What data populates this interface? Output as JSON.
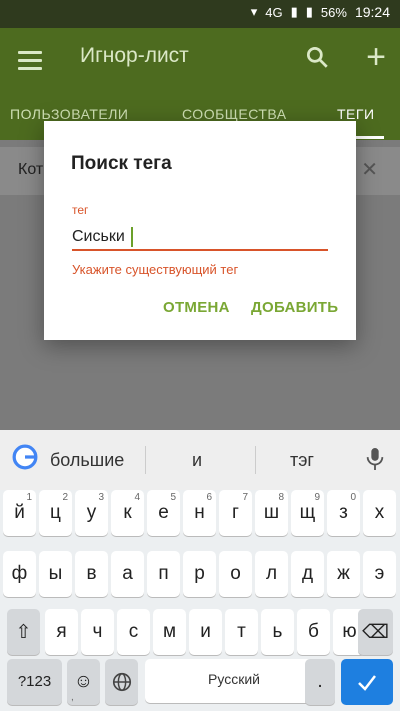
{
  "status": {
    "network": "4G",
    "battery": "56%",
    "time": "19:24"
  },
  "appbar": {
    "title": "Игнор-лист"
  },
  "tabs": [
    {
      "label": "ПОЛЬЗОВАТЕЛИ"
    },
    {
      "label": "СООБЩЕСТВА"
    },
    {
      "label": "ТЕГИ"
    }
  ],
  "content": {
    "row_text": "Кот"
  },
  "dialog": {
    "title": "Поиск тега",
    "field_label": "тег",
    "field_value": "Сиськи",
    "error": "Укажите существующий тег",
    "cancel": "ОТМЕНА",
    "add": "ДОБАВИТЬ"
  },
  "suggestions": [
    "большие",
    "и",
    "тэг"
  ],
  "keyboard": {
    "row1": [
      {
        "l": "й",
        "n": "1"
      },
      {
        "l": "ц",
        "n": "2"
      },
      {
        "l": "у",
        "n": "3"
      },
      {
        "l": "к",
        "n": "4"
      },
      {
        "l": "е",
        "n": "5"
      },
      {
        "l": "н",
        "n": "6"
      },
      {
        "l": "г",
        "n": "7"
      },
      {
        "l": "ш",
        "n": "8"
      },
      {
        "l": "щ",
        "n": "9"
      },
      {
        "l": "з",
        "n": "0"
      },
      {
        "l": "х",
        "n": ""
      }
    ],
    "row2": [
      "ф",
      "ы",
      "в",
      "а",
      "п",
      "р",
      "о",
      "л",
      "д",
      "ж",
      "э"
    ],
    "row3": [
      "я",
      "ч",
      "с",
      "м",
      "и",
      "т",
      "ь",
      "б",
      "ю"
    ],
    "symbols": "?123",
    "space": "Русский",
    "comma": ",",
    "period": "."
  },
  "colors": {
    "accent": "#7aa734",
    "error": "#d8542a",
    "appbar": "#4d6b1f"
  }
}
